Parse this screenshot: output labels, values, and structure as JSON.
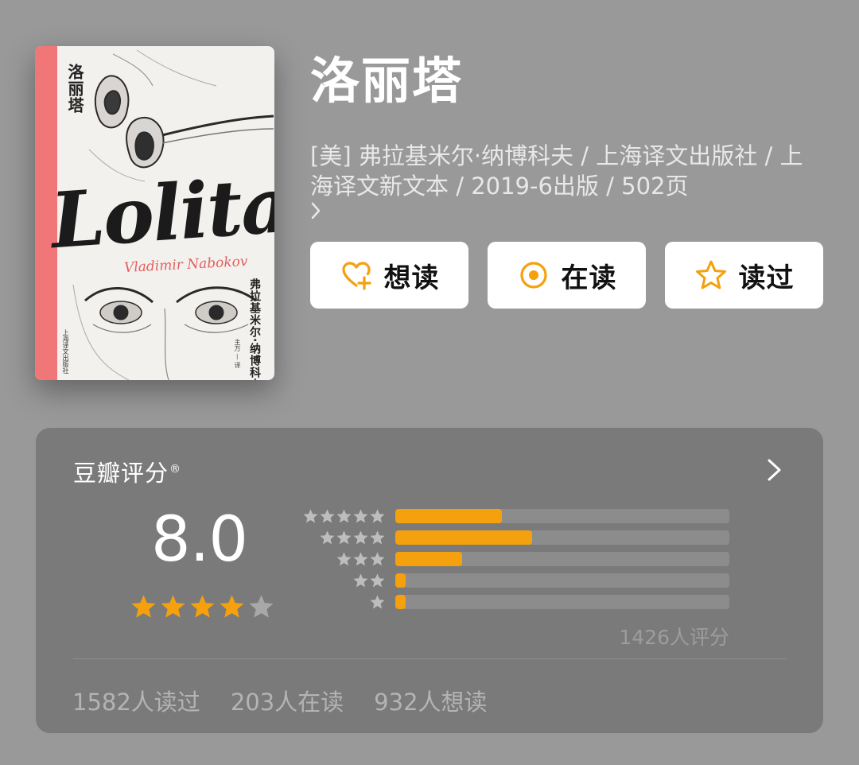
{
  "cover": {
    "title_cn": "洛丽塔",
    "title_en": "Lolita",
    "author_en": "Vladimir Nabokov",
    "author_cn": "弗拉基米尔·纳博科夫",
    "translator": "主万 — 译",
    "publisher": "上海译文出版社",
    "spine_color": "#f07677"
  },
  "book": {
    "title": "洛丽塔",
    "meta": "[美] 弗拉基米尔·纳博科夫 / 上海译文出版社 / 上海译文新文本 / 2019-6出版 / 502页"
  },
  "actions": [
    {
      "label": "想读",
      "icon": "heart-plus-icon"
    },
    {
      "label": "在读",
      "icon": "target-circle-icon"
    },
    {
      "label": "读过",
      "icon": "star-outline-icon"
    }
  ],
  "rating": {
    "title": "豆瓣评分",
    "title_mark": "®",
    "score": "8.0",
    "score_stars": 4,
    "star_color": "#f5a00d",
    "distribution": [
      {
        "stars": 5,
        "fraction": 0.32
      },
      {
        "stars": 4,
        "fraction": 0.41
      },
      {
        "stars": 3,
        "fraction": 0.2
      },
      {
        "stars": 2,
        "fraction": 0.03
      },
      {
        "stars": 1,
        "fraction": 0.03
      }
    ],
    "count_text": "1426人评分"
  },
  "stats": {
    "read": "1582人读过",
    "reading": "203人在读",
    "want": "932人想读"
  }
}
